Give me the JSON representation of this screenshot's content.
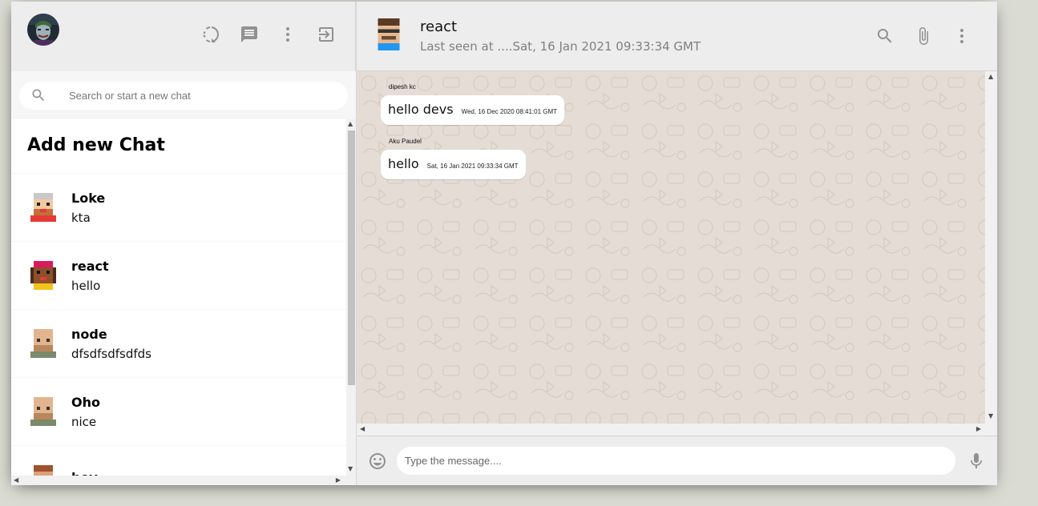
{
  "sidebar": {
    "header": {
      "icons": [
        "status-icon",
        "new-chat-icon",
        "more-vert-icon",
        "logout-icon"
      ]
    },
    "search": {
      "placeholder": "Search or start a new chat"
    },
    "add_new_chat_label": "Add new Chat",
    "chats": [
      {
        "name": "Loke",
        "last_message": "kta",
        "avatar_color": "#e53935"
      },
      {
        "name": "react",
        "last_message": "hello",
        "avatar_color": "#d81b60"
      },
      {
        "name": "node",
        "last_message": "dfsdfsdfsdfds",
        "avatar_color": "#d8a77a"
      },
      {
        "name": "Oho",
        "last_message": "nice",
        "avatar_color": "#d8a77a"
      },
      {
        "name": "hey",
        "last_message": "",
        "avatar_color": "#a0522d"
      }
    ]
  },
  "chat": {
    "header": {
      "name": "react",
      "last_seen": "Last seen at ....Sat, 16 Jan 2021 09:33:34 GMT",
      "icons": [
        "search-icon",
        "attach-icon",
        "more-vert-icon"
      ]
    },
    "messages": [
      {
        "sender": "dipesh kc",
        "text": "hello devs",
        "timestamp": "Wed, 16 Dec 2020 08:41:01 GMT"
      },
      {
        "sender": "Aku Paudel",
        "text": "hello",
        "timestamp": "Sat, 16 Jan 2021 09:33:34 GMT"
      }
    ],
    "footer": {
      "placeholder": "Type the message....",
      "icons": [
        "emoji-icon",
        "mic-icon"
      ]
    }
  },
  "colors": {
    "background": "#dadbd3",
    "header_bg": "#ededed",
    "chat_bg": "#e5ddd5",
    "icon_gray": "#919191"
  }
}
